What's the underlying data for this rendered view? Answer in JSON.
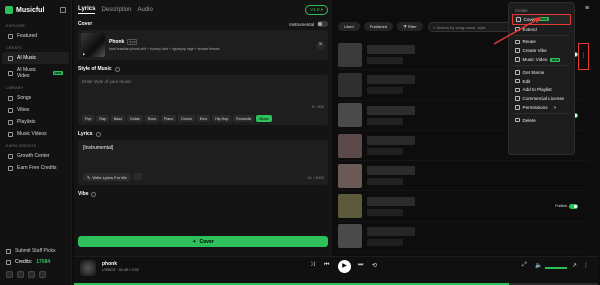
{
  "app": {
    "name": "Musicful"
  },
  "sidebar": {
    "explore_label": "EXPLORE",
    "featured": "Featured",
    "create_label": "CREATE",
    "ai_music": "AI Music",
    "ai_music_video": "AI Music Video",
    "new_badge": "NEW",
    "library_label": "LIBRARY",
    "songs": "Songs",
    "vibes": "Vibes",
    "playlists": "Playlists",
    "music_videos": "Music Videos",
    "earn_label": "EARN CREDITS",
    "growth_center": "Growth Center",
    "earn_free_credits": "Earn Free Credits",
    "submit_staff_picks": "Submit Staff Picks",
    "credits_label": "Credits:",
    "credits_value": "17084"
  },
  "creator": {
    "tabs": [
      "Lyrics",
      "Description",
      "Audio"
    ],
    "version": "V1.0",
    "cover_label": "Cover",
    "instrumental_label": "Instrumental",
    "cover_title": "Phonk",
    "cover_version": "V1.5",
    "cover_desc": "hard brazilian phonk drift + bouncy club + hyperpop rage + slowed threats",
    "style_label": "Style of Music",
    "style_placeholder": "Enter style of your music",
    "style_count": "0 / 300",
    "chips": [
      "Pop",
      "Rap",
      "Bass",
      "Guitar",
      "Rock",
      "Piano",
      "Drums",
      "Emo",
      "Hip Hop",
      "Romantic",
      "Music"
    ],
    "lyrics_label": "Lyrics",
    "lyrics_value": "[Instrumental]",
    "lyrics_count": "14 / 3000",
    "write_lyrics_btn": "Write Lyrics For Me",
    "vibe_label": "Vibe",
    "cover_button": "Cover"
  },
  "songs_panel": {
    "filters": [
      "Liked",
      "Published",
      "Filter"
    ],
    "search_placeholder": "Search by song name, style",
    "published_label": "Publish",
    "row_count": 7
  },
  "context_menu": {
    "header": "Create",
    "items": [
      {
        "label": "Cover",
        "badge": "NEW",
        "icon": "cover-icon"
      },
      {
        "label": "Extend",
        "icon": "extend-icon"
      },
      {
        "label": "Reuse",
        "icon": "reuse-icon"
      },
      {
        "label": "Create Vibe",
        "icon": "vibe-icon"
      },
      {
        "label": "Music Video",
        "badge": "NEW",
        "icon": "video-icon"
      },
      {
        "label": "Get Stems",
        "icon": "stems-icon"
      },
      {
        "label": "Edit",
        "icon": "edit-icon"
      },
      {
        "label": "Add to Playlist",
        "icon": "playlist-icon"
      },
      {
        "label": "Commercial License",
        "icon": "license-icon"
      },
      {
        "label": "Permissions",
        "icon": "permissions-icon",
        "chevron": ">"
      },
      {
        "label": "Delete",
        "icon": "trash-icon"
      }
    ]
  },
  "player": {
    "title": "phonk",
    "meta": "LYRICS · 01:49 / 2:02",
    "progress": 0.83,
    "accent": "#2ec05a"
  }
}
